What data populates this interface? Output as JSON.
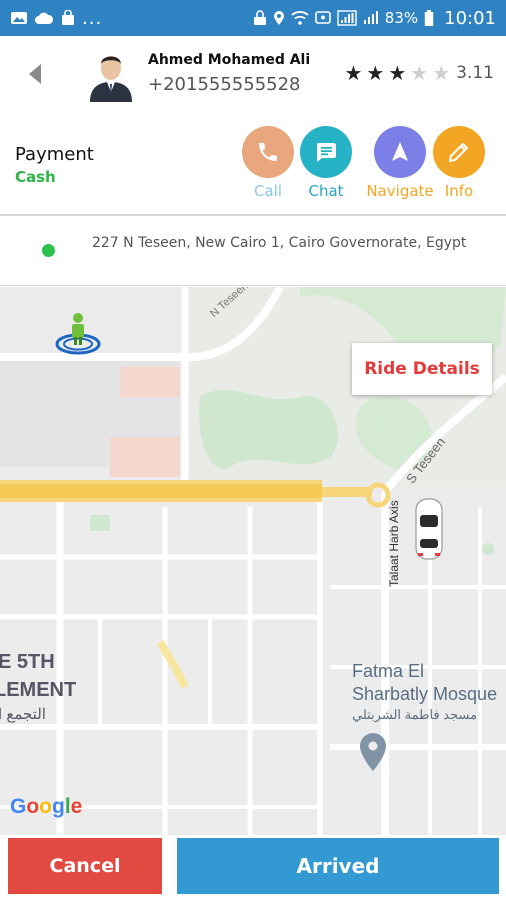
{
  "status_bar": {
    "dots": "...",
    "battery": "83%",
    "time": "10:01"
  },
  "driver": {
    "name": "Ahmed Mohamed Ali",
    "phone": "+201555555528",
    "rating_value": "3.11",
    "stars_filled": 3,
    "stars_total": 5
  },
  "payment": {
    "label": "Payment",
    "method": "Cash"
  },
  "actions": {
    "call": "Call",
    "chat": "Chat",
    "navigate": "Navigate",
    "info": "Info"
  },
  "address": {
    "text": "227 N Teseen, New Cairo 1, Cairo Governorate, Egypt"
  },
  "map": {
    "ride_details_button": "Ride Details",
    "street_n_teseen": "N Teseen",
    "street_s_teseen": "S Teseen",
    "street_talaat": "Talaat Harb Axis",
    "area_line1": "E 5TH",
    "area_line2": "LEMENT",
    "area_arabic": "التجمع ا",
    "poi_en_line1": "Fatma El",
    "poi_en_line2": "Sharbatly Mosque",
    "poi_ar": "مسجد فاطمة الشربتلي",
    "google": "Google"
  },
  "buttons": {
    "cancel": "Cancel",
    "arrived": "Arrived"
  },
  "colors": {
    "status_bar": "#2f83c3",
    "cash": "#2fb34a",
    "cancel": "#e24a41",
    "arrived": "#3399d2",
    "ride_details": "#e23b3b"
  }
}
